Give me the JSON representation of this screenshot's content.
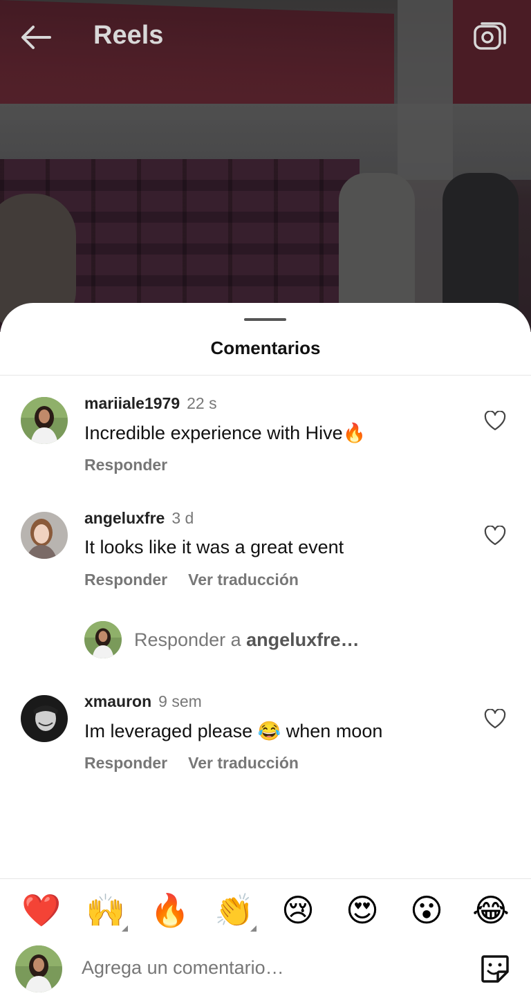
{
  "header": {
    "title": "Reels",
    "back_icon": "back-arrow-icon",
    "camera_icon": "camera-icon"
  },
  "sheet": {
    "title": "Comentarios"
  },
  "comments": [
    {
      "username": "mariiale1979",
      "time": "22 s",
      "text": "Incredible experience with Hive🔥",
      "actions": [
        "Responder"
      ]
    },
    {
      "username": "angeluxfre",
      "time": "3 d",
      "text": "It looks like it was a great event",
      "actions": [
        "Responder",
        "Ver traducción"
      ]
    },
    {
      "username": "xmauron",
      "time": "9 sem",
      "text": "Im leveraged please 😂 when moon",
      "actions": [
        "Responder",
        "Ver traducción"
      ]
    }
  ],
  "reply_prompt": {
    "prefix": "Responder a ",
    "target": "angeluxfre…"
  },
  "emoji_bar": [
    "❤️",
    "🙌",
    "🔥",
    "👏",
    "😢",
    "😍",
    "😮",
    "😂"
  ],
  "composer": {
    "placeholder": "Agrega un comentario…",
    "sticker_icon": "sticker-icon"
  },
  "colors": {
    "text_primary": "#111111",
    "text_secondary": "#777777",
    "sheet_bg": "#ffffff"
  }
}
